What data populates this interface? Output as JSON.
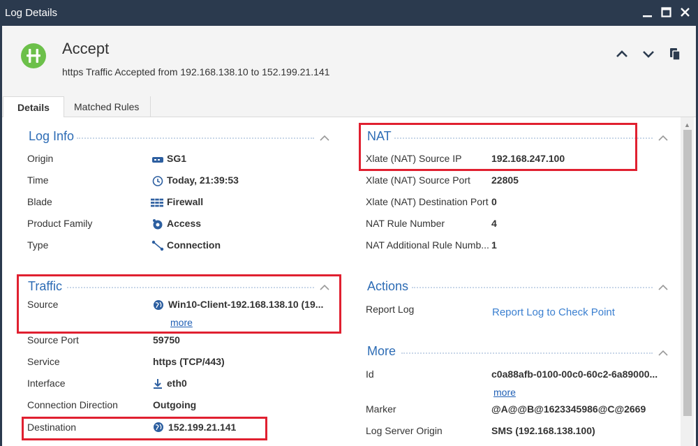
{
  "window": {
    "title": "Log Details"
  },
  "header": {
    "action": "Accept",
    "description": "https Traffic Accepted from 192.168.138.10 to 152.199.21.141"
  },
  "tabs": [
    {
      "label": "Details"
    },
    {
      "label": "Matched Rules"
    }
  ],
  "log_info": {
    "title": "Log Info",
    "rows": [
      {
        "label": "Origin",
        "value": "SG1",
        "icon": "gateway-icon"
      },
      {
        "label": "Time",
        "value": "Today, 21:39:53",
        "icon": "clock-icon"
      },
      {
        "label": "Blade",
        "value": "Firewall",
        "icon": "firewall-icon"
      },
      {
        "label": "Product Family",
        "value": "Access",
        "icon": "access-icon"
      },
      {
        "label": "Type",
        "value": "Connection",
        "icon": "connection-icon"
      }
    ]
  },
  "traffic": {
    "title": "Traffic",
    "source_label": "Source",
    "source_value": "Win10-Client-192.168.138.10 (19...",
    "source_more": "more",
    "rows": [
      {
        "label": "Source Port",
        "value": "59750"
      },
      {
        "label": "Service",
        "value": "https (TCP/443)"
      },
      {
        "label": "Interface",
        "value": "eth0"
      },
      {
        "label": "Connection Direction",
        "value": "Outgoing"
      }
    ],
    "destination_label": "Destination",
    "destination_value": "152.199.21.141"
  },
  "nat": {
    "title": "NAT",
    "rows": [
      {
        "label": "Xlate (NAT) Source IP",
        "value": "192.168.247.100"
      },
      {
        "label": "Xlate (NAT) Source Port",
        "value": "22805"
      },
      {
        "label": "Xlate (NAT) Destination Port",
        "value": "0"
      },
      {
        "label": "NAT Rule Number",
        "value": "4"
      },
      {
        "label": "NAT Additional Rule Numb...",
        "value": "1"
      }
    ]
  },
  "actions": {
    "title": "Actions",
    "report_label": "Report Log",
    "report_link": "Report Log to Check Point"
  },
  "more": {
    "title": "More",
    "id_label": "Id",
    "id_value": "c0a88afb-0100-00c0-60c2-6a89000...",
    "id_more": "more",
    "marker_label": "Marker",
    "marker_value": "@A@@B@1623345986@C@2669",
    "server_label": "Log Server Origin",
    "server_value": "SMS (192.168.138.100)"
  },
  "colors": {
    "titlebar": "#2b3a4e",
    "accent": "#2d6cb5",
    "accept_green": "#6cc04a",
    "highlight_red": "#e02030"
  }
}
